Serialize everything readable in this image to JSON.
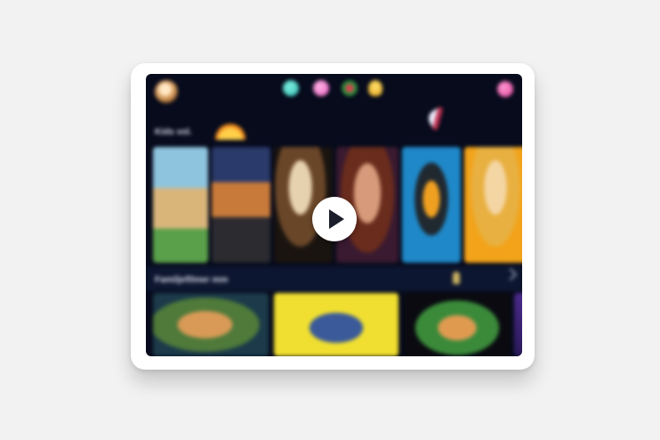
{
  "app": {
    "row1_title": "Kids vol.",
    "row2_title": "Familjefilmer mm",
    "play_label": "Play",
    "colors": {
      "frame": "#ffffff",
      "screen_bg": "#070b1c",
      "background": "#f2f2f2",
      "accent_pink": "#e0409a"
    }
  },
  "icons": {
    "avatar": "avatar-icon",
    "nav": [
      "teal-character-icon",
      "pink-character-icon",
      "flower-icon",
      "balloon-icon"
    ],
    "profile": "profile-icon",
    "decor": [
      "rocket-icon",
      "sun-icon"
    ],
    "play": "play-icon"
  },
  "rows": [
    {
      "posters": [
        "giraffe",
        "fox",
        "bearded-man",
        "girl",
        "hero",
        "blonde-girl"
      ]
    },
    {
      "tiles": [
        "kids-tile",
        "couple-tile",
        "monster-tile",
        "purple-tile"
      ]
    }
  ]
}
